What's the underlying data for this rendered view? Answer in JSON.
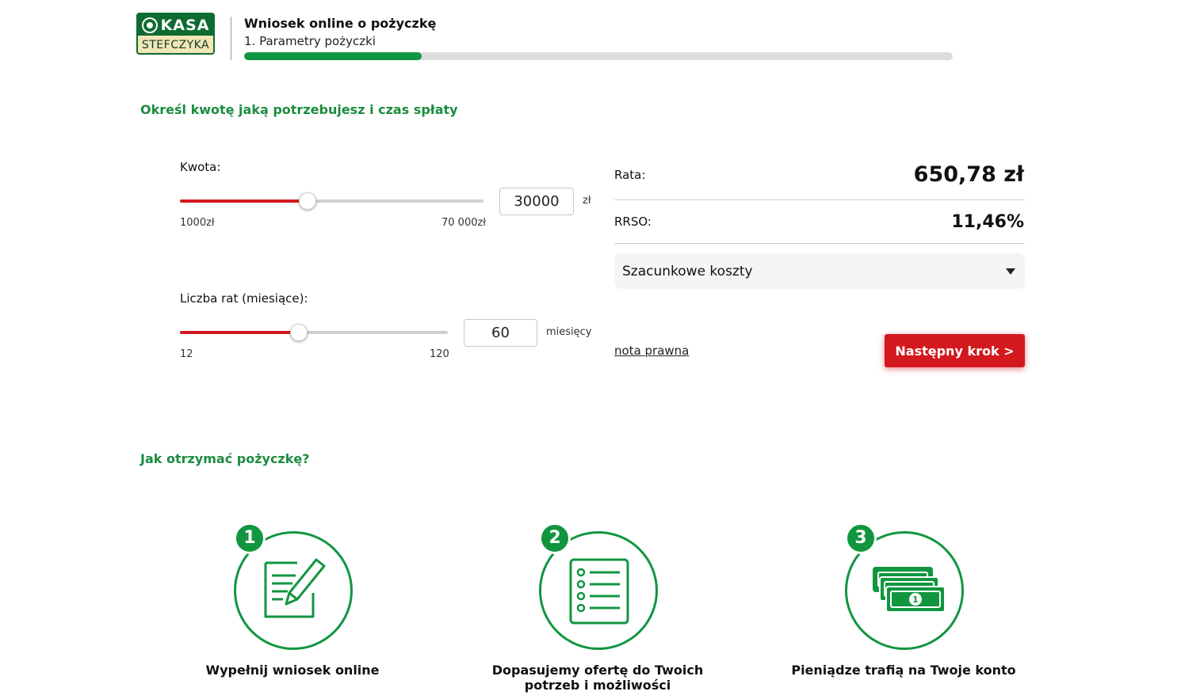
{
  "header": {
    "logo_top": "KASA",
    "logo_bottom": "STEFCZYKA",
    "title": "Wniosek online o pożyczkę",
    "step": "1. Parametry pożyczki",
    "progress_fraction": 0.25,
    "accent_color": "#11963f"
  },
  "section1": {
    "heading": "Określ kwotę jaką potrzebujesz i czas spłaty"
  },
  "amount": {
    "label": "Kwota:",
    "min_label": "1000zł",
    "max_label": "70 000zł",
    "min": 1000,
    "max": 70000,
    "value": 30000,
    "value_text": "30000",
    "unit": "zł"
  },
  "term": {
    "label": "Liczba rat (miesiące):",
    "min_label": "12",
    "max_label": "120",
    "min": 12,
    "max": 120,
    "value": 60,
    "value_text": "60",
    "unit": "miesięcy"
  },
  "summary": {
    "installment_label": "Rata:",
    "installment_value": "650,78 zł",
    "rrso_label": "RRSO:",
    "rrso_value": "11,46%",
    "costs_label": "Szacunkowe koszty",
    "legal_link": "nota prawna",
    "next_button": "Następny krok >",
    "button_color": "#d3191e"
  },
  "section2": {
    "heading": "Jak otrzymać pożyczkę?"
  },
  "steps": [
    {
      "number": "1",
      "icon": "form-pen-icon",
      "caption": "Wypełnij wniosek online"
    },
    {
      "number": "2",
      "icon": "checklist-icon",
      "caption": "Dopasujemy ofertę do Twoich potrzeb i możliwości"
    },
    {
      "number": "3",
      "icon": "banknotes-icon",
      "caption": "Pieniądze trafią na Twoje konto"
    }
  ]
}
